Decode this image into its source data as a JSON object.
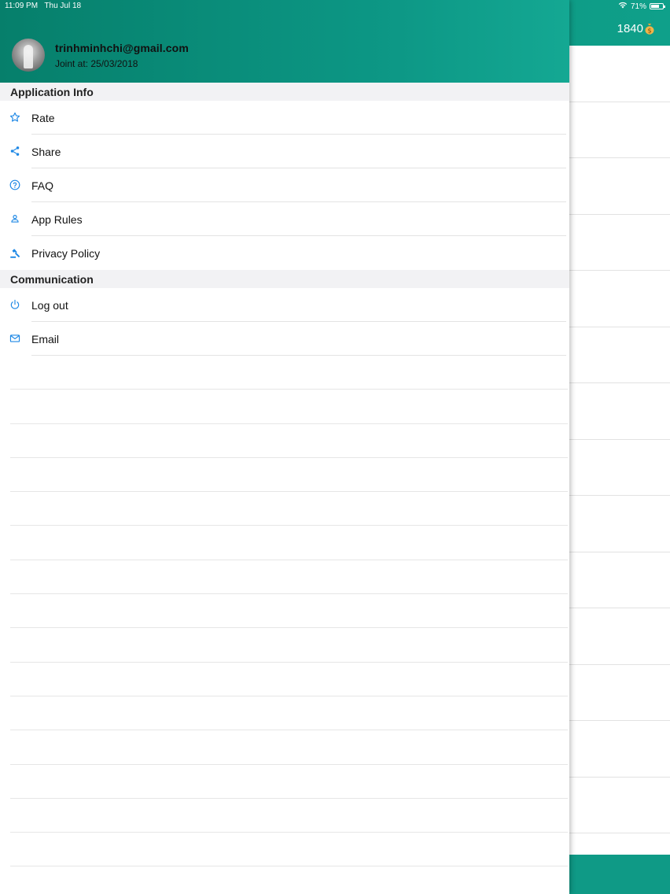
{
  "status_bar": {
    "time": "11:09 PM",
    "date": "Thu Jul 18",
    "battery": "71%"
  },
  "background": {
    "coins": "1840"
  },
  "profile": {
    "email": "trinhminhchi@gmail.com",
    "joined": "Joint at: 25/03/2018"
  },
  "sections": {
    "app_info": {
      "title": "Application Info",
      "items": [
        {
          "label": "Rate",
          "icon": "star-icon"
        },
        {
          "label": "Share",
          "icon": "share-icon"
        },
        {
          "label": "FAQ",
          "icon": "question-icon"
        },
        {
          "label": "App Rules",
          "icon": "person-icon"
        },
        {
          "label": "Privacy Policy",
          "icon": "gavel-icon"
        }
      ]
    },
    "communication": {
      "title": "Communication",
      "items": [
        {
          "label": "Log out",
          "icon": "power-icon"
        },
        {
          "label": "Email",
          "icon": "mail-icon"
        }
      ]
    }
  },
  "colors": {
    "header": "#0d9886",
    "accent": "#1e88e5"
  }
}
